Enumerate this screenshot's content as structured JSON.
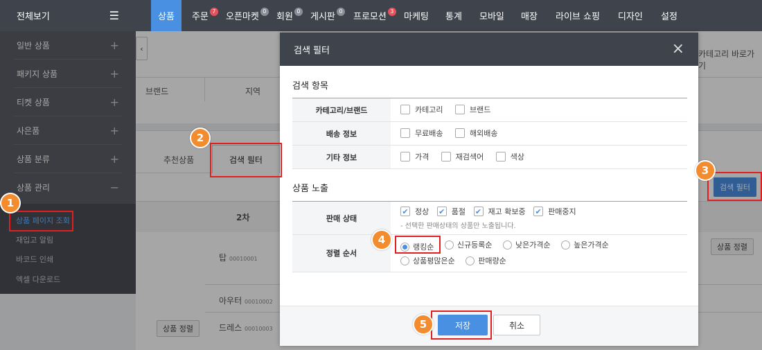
{
  "sidebar": {
    "title": "전체보기",
    "items": [
      {
        "label": "일반 상품",
        "toggle": "+"
      },
      {
        "label": "패키지 상품",
        "toggle": "+"
      },
      {
        "label": "티켓 상품",
        "toggle": "+"
      },
      {
        "label": "사은품",
        "toggle": "+"
      },
      {
        "label": "상품 분류",
        "toggle": "+"
      },
      {
        "label": "상품 관리",
        "toggle": "−"
      }
    ],
    "sub_items": [
      "상품 페이지 조회",
      "재입고 알림",
      "바코드 인쇄",
      "엑셀 다운로드"
    ]
  },
  "topnav": {
    "items": [
      {
        "label": "상품"
      },
      {
        "label": "주문",
        "badge": "7"
      },
      {
        "label": "오픈마켓",
        "badge": "0"
      },
      {
        "label": "회원",
        "badge": "0"
      },
      {
        "label": "게시판",
        "badge": "0"
      },
      {
        "label": "프로모션",
        "badge": "3"
      },
      {
        "label": "마케팅"
      },
      {
        "label": "통계"
      },
      {
        "label": "모바일"
      },
      {
        "label": "매장"
      },
      {
        "label": "라이브 쇼핑"
      },
      {
        "label": "디자인"
      },
      {
        "label": "설정"
      }
    ]
  },
  "background": {
    "collapse_arrow": "‹",
    "category_shortcut": "카테고리 바로가기",
    "col_brand": "브랜드",
    "col_region": "지역",
    "tab_recommended": "추천상품",
    "tab_search_filter": "검색 필터",
    "search_filter_button": "검색 필터",
    "col_second": "2차",
    "product_sort_button": "상품 정렬",
    "rows": [
      {
        "name": "탑",
        "code": "00010001"
      },
      {
        "name": "아우터",
        "code": "00010002"
      },
      {
        "name": "드레스",
        "code": "00010003"
      }
    ],
    "product_sort_button_left": "상품 정렬"
  },
  "modal": {
    "title": "검색 필터",
    "close": "×",
    "section1": "검색 항목",
    "rows1": [
      {
        "label": "카테고리/브랜드",
        "options": [
          "카테고리",
          "브랜드"
        ]
      },
      {
        "label": "배송 정보",
        "options": [
          "무료배송",
          "해외배송"
        ]
      },
      {
        "label": "기타 정보",
        "options": [
          "가격",
          "재검색어",
          "색상"
        ]
      }
    ],
    "section2": "상품 노출",
    "sale_status": {
      "label": "판매 상태",
      "options": [
        "정상",
        "품절",
        "재고 확보중",
        "판매중지"
      ],
      "hint": "- 선택한 판매상태의 상품만 노출됩니다."
    },
    "sort_order": {
      "label": "정렬 순서",
      "options": [
        "랭킹순",
        "신규등록순",
        "낮은가격순",
        "높은가격순",
        "상품평많은순",
        "판매량순"
      ],
      "selected": "랭킹순"
    },
    "save": "저장",
    "cancel": "취소"
  },
  "steps": [
    "1",
    "2",
    "3",
    "4",
    "5"
  ],
  "colors": {
    "accent": "#4a90e2",
    "step": "#f28c2e",
    "highlight": "#e02020"
  }
}
